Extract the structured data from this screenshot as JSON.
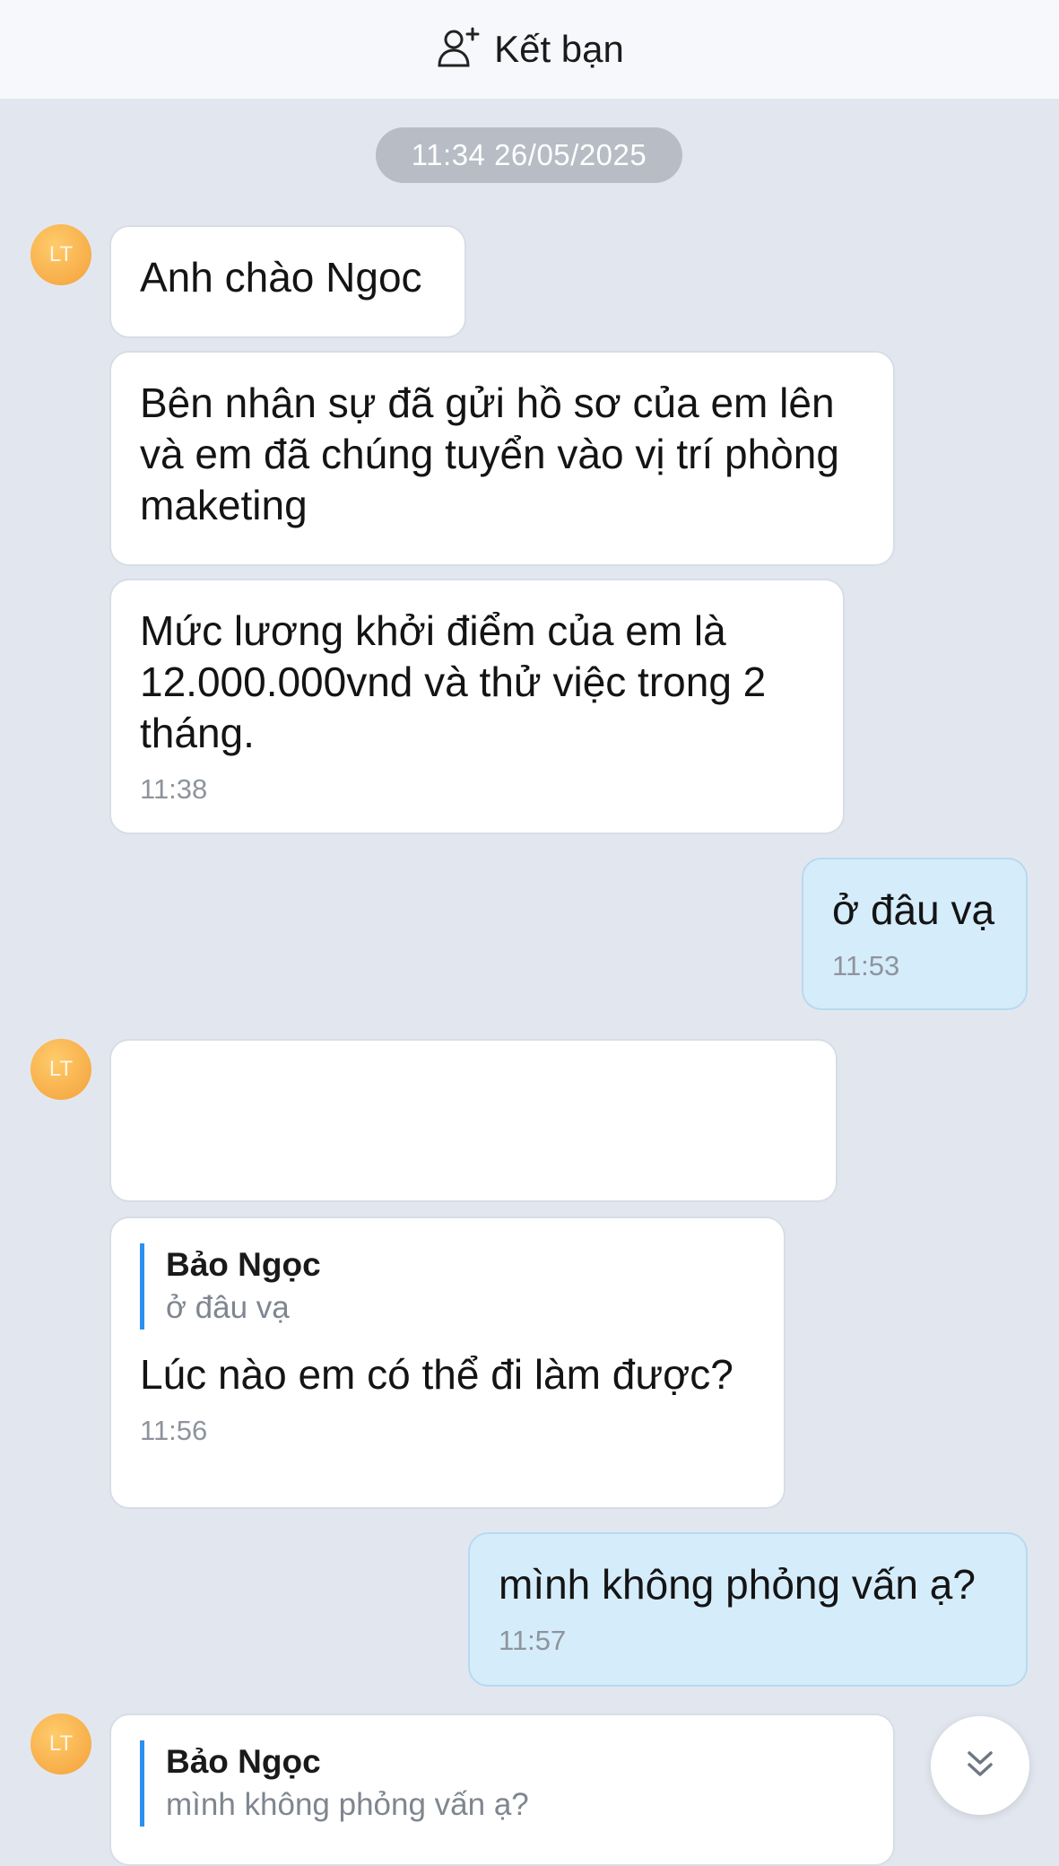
{
  "header": {
    "add_friend_label": "Kết bạn",
    "icon": "add-user-icon"
  },
  "date_separator": "11:34 26/05/2025",
  "contact": {
    "avatar_initials": "LT"
  },
  "messages": [
    {
      "text": "Anh chào Ngoc"
    },
    {
      "text": "Bên nhân sự đã gửi hồ sơ của em lên và em đã chúng tuyển vào vị trí phòng maketing"
    },
    {
      "text": "Mức lương khởi điểm của em là 12.000.000vnd và thử việc trong 2 tháng.",
      "time": "11:38"
    },
    {
      "text": "ở đâu vạ",
      "time": "11:53",
      "mine": true
    },
    {
      "text": ""
    },
    {
      "quote_name": "Bảo Ngọc",
      "quote_text": "ở đâu vạ",
      "text": "Lúc nào em có thể đi làm được?",
      "time": "11:56"
    },
    {
      "text": "mình không phỏng vấn ạ?",
      "time": "11:57",
      "mine": true
    },
    {
      "quote_name": "Bảo Ngọc",
      "quote_text": "mình không phỏng vấn ạ?"
    }
  ],
  "scroll_button": {
    "icon": "double-chevron-down-icon"
  }
}
